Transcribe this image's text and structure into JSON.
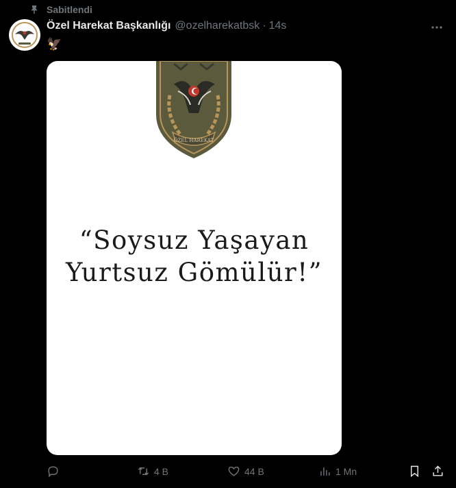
{
  "pinned": {
    "label": "Sabitlendi",
    "icon": "pin-icon"
  },
  "author": {
    "name": "Özel Harekat Başkanlığı",
    "handle": "@ozelharekatbsk",
    "separator": "·",
    "time": "14s",
    "avatar_icon": "eagle-emblem-avatar"
  },
  "tweet": {
    "text": "🦅"
  },
  "media": {
    "quote_line1": "“Soysuz Yaşayan",
    "quote_line2": "Yurtsuz Gömülür!”",
    "emblem_text": "ÖZEL HAREKAT",
    "background": "#ffffff"
  },
  "actions": {
    "reply": {
      "icon": "reply-icon",
      "count": ""
    },
    "retweet": {
      "icon": "retweet-icon",
      "count": "4 B"
    },
    "like": {
      "icon": "heart-icon",
      "count": "44 B"
    },
    "views": {
      "icon": "views-icon",
      "count": "1 Mn"
    },
    "bookmark": {
      "icon": "bookmark-icon"
    },
    "share": {
      "icon": "share-icon"
    }
  },
  "colors": {
    "background": "#000000",
    "text_primary": "#e7e9ea",
    "text_secondary": "#71767b",
    "emblem_olive": "#5c5a3c",
    "emblem_gold": "#b8955a"
  }
}
